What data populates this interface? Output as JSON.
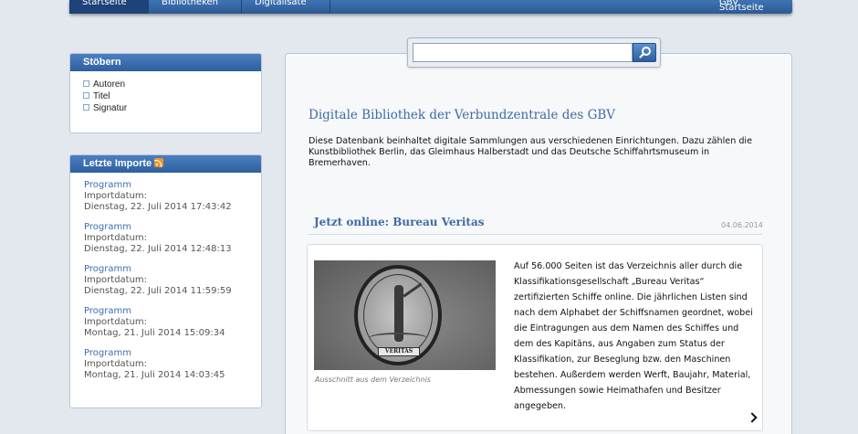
{
  "nav": {
    "tabs": [
      "Startseite",
      "Bibliotheken",
      "Digitalisate"
    ],
    "right_link": "GBV Startseite"
  },
  "browse": {
    "title": "Stöbern",
    "items": [
      "Autoren",
      "Titel",
      "Signatur"
    ]
  },
  "imports": {
    "title": "Letzte Importe",
    "items": [
      {
        "title": "Programm",
        "label": "Importdatum:",
        "date": "Dienstag, 22. Juli 2014 17:43:42"
      },
      {
        "title": "Programm",
        "label": "Importdatum:",
        "date": "Dienstag, 22. Juli 2014 12:48:13"
      },
      {
        "title": "Programm",
        "label": "Importdatum:",
        "date": "Dienstag, 22. Juli 2014 11:59:59"
      },
      {
        "title": "Programm",
        "label": "Importdatum:",
        "date": "Montag, 21. Juli 2014 15:09:34"
      },
      {
        "title": "Programm",
        "label": "Importdatum:",
        "date": "Montag, 21. Juli 2014 14:03:45"
      }
    ]
  },
  "search": {
    "value": "",
    "placeholder": ""
  },
  "main": {
    "title": "Digitale Bibliothek der Verbundzentrale des GBV",
    "intro": "Diese Datenbank beinhaltet digitale Sammlungen aus verschiedenen Einrichtungen. Dazu zählen die Kunstbibliothek Berlin, das Gleimhaus Halberstadt und das Deutsche Schiffahrtsmuseum in Bremerhaven."
  },
  "news": {
    "title": "Jetzt online: Bureau Veritas",
    "date": "04.06.2014",
    "image_label": "VERITAS",
    "caption": "Ausschnitt aus dem Verzeichnis",
    "text": "Auf 56.000 Seiten ist das Verzeichnis aller durch die Klassifikationsgesellschaft „Bureau Veritas“ zertifizierten Schiffe online. Die jährlichen Listen sind nach dem Alphabet der Schiffsnamen geordnet, wobei die Eintragungen aus dem Namen des Schiffes und dem des Kapitäns, aus Angaben zum Status der Klassifikation, zur Beseglung bzw. den Maschinen bestehen. Außerdem werden Werft, Baujahr, Material, Abmessungen sowie Heimathafen und Besitzer angegeben."
  },
  "colors": {
    "accent": "#3d6ba6",
    "nav_bar": "#2c5a95",
    "background": "#e3e8ee"
  }
}
